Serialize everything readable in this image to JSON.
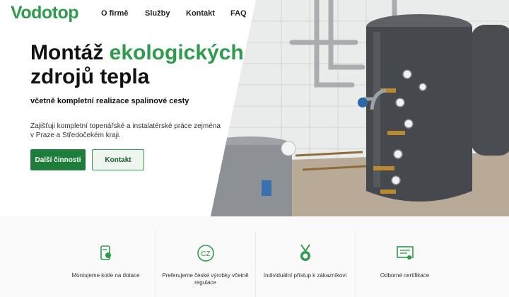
{
  "brand": {
    "logo": "Vodotop",
    "accent_color": "#2f9c4d",
    "dark_green": "#1e7d3a"
  },
  "nav": {
    "items": [
      {
        "label": "O firmě"
      },
      {
        "label": "Služby"
      },
      {
        "label": "Kontakt"
      },
      {
        "label": "FAQ"
      }
    ]
  },
  "hero": {
    "title_part1": "Montáž ",
    "title_accent": "ekologických",
    "title_part2": "zdrojů tepla",
    "subtitle": "včetně kompletní realizace spalinové cesty",
    "description": "Zajišťuji kompletní topenářské a instalatérské práce zejména v Praze a Středočekém kraji.",
    "primary_button": "Další činnosti",
    "secondary_button": "Kontakt",
    "image": "boiler-room-photo"
  },
  "features": [
    {
      "icon": "boiler-icon",
      "label": "Montujeme kotle na dotace"
    },
    {
      "icon": "cz-badge-icon",
      "label": "Preferujeme české výrobky včetně regulace"
    },
    {
      "icon": "medal-icon",
      "label": "Individuální přístup k zákazníkovi"
    },
    {
      "icon": "certificate-icon",
      "label": "Odborné certifikace"
    }
  ]
}
